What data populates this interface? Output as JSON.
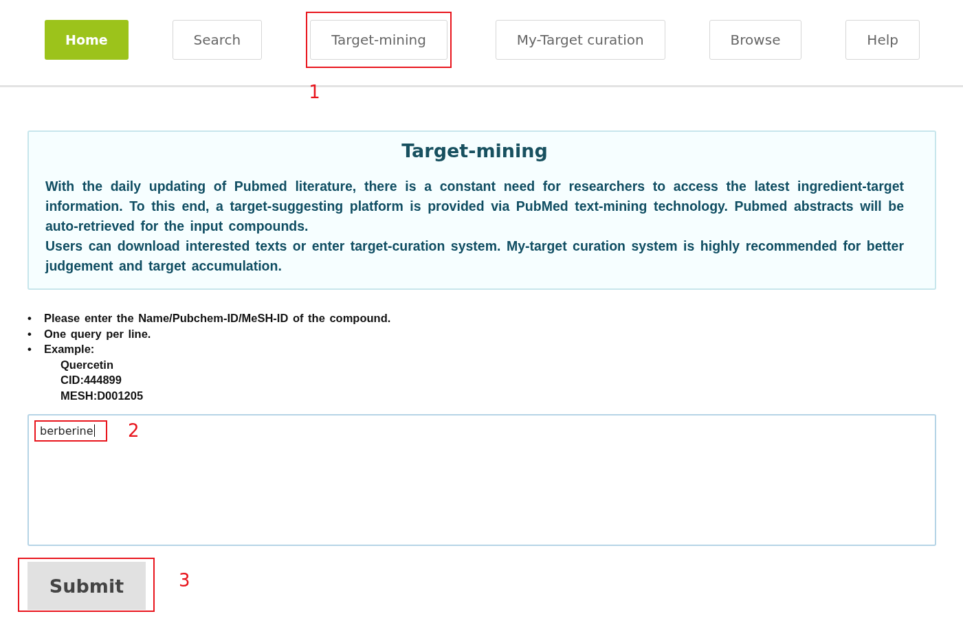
{
  "nav": {
    "items": [
      {
        "label": "Home",
        "selected": true,
        "marker": null
      },
      {
        "label": "Search",
        "selected": false,
        "marker": null
      },
      {
        "label": "Target-mining",
        "selected": false,
        "marker": "1"
      },
      {
        "label": "My-Target curation",
        "selected": false,
        "marker": null
      },
      {
        "label": "Browse",
        "selected": false,
        "marker": null
      },
      {
        "label": "Help",
        "selected": false,
        "marker": null
      }
    ]
  },
  "intro": {
    "title": "Target-mining",
    "paragraphs": [
      "With the daily updating of Pubmed literature, there is a constant need for researchers to access the latest ingredient-target information. To this end, a target-suggesting platform is provided via PubMed text-mining technology. Pubmed abstracts will be auto-retrieved for the input compounds.",
      "Users can download interested texts or enter target-curation system. My-target curation system is highly recommended for better judgement and target accumulation."
    ]
  },
  "instructions": {
    "items": [
      {
        "bullet": "•",
        "text": "Please enter the Name/Pubchem-ID/MeSH-ID of the compound."
      },
      {
        "bullet": "•",
        "text": "One query per line."
      },
      {
        "bullet": "•",
        "text": "Example:"
      }
    ],
    "examples": [
      "Quercetin",
      "CID:444899",
      "MESH:D001205"
    ]
  },
  "query": {
    "value": "berberine",
    "marker": "2"
  },
  "submit": {
    "label": "Submit",
    "marker": "3"
  }
}
